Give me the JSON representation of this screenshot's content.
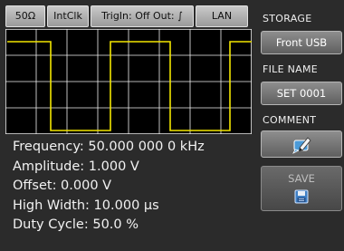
{
  "status_bar": {
    "impedance": "50Ω",
    "clock": "IntClk",
    "trigger": "TrigIn: Off Out: ∫",
    "interface": "LAN"
  },
  "waveform": {
    "type": "square",
    "color": "#f2e600",
    "grid_color": "#ffffff",
    "background": "#000000"
  },
  "parameters": {
    "frequency": "Frequency: 50.000 000 0 kHz",
    "amplitude": "Amplitude: 1.000 V",
    "offset": "Offset: 0.000 V",
    "high_width": "High Width: 10.000 µs",
    "duty_cycle": "Duty Cycle: 50.0 %"
  },
  "side_panel": {
    "storage_title": "STORAGE",
    "storage_value": "Front USB",
    "file_name_title": "FILE NAME",
    "file_name_value": "SET 0001",
    "comment_title": "COMMENT",
    "comment_icon": "comment-edit-icon",
    "save_label": "SAVE",
    "save_icon": "floppy-disk-icon"
  }
}
